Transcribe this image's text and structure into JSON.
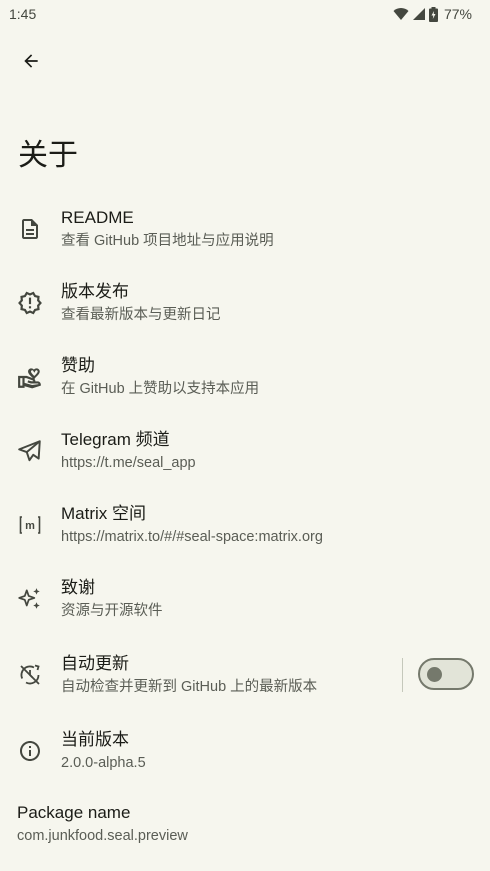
{
  "status": {
    "time": "1:45",
    "battery": "77%"
  },
  "page": {
    "title": "关于"
  },
  "items": [
    {
      "key": "readme",
      "title": "README",
      "desc": "查看 GitHub 项目地址与应用说明"
    },
    {
      "key": "releases",
      "title": "版本发布",
      "desc": "查看最新版本与更新日记"
    },
    {
      "key": "sponsor",
      "title": "赞助",
      "desc": "在 GitHub 上赞助以支持本应用"
    },
    {
      "key": "telegram",
      "title": "Telegram 频道",
      "desc": "https://t.me/seal_app"
    },
    {
      "key": "matrix",
      "title": "Matrix 空间",
      "desc": "https://matrix.to/#/#seal-space:matrix.org"
    },
    {
      "key": "credits",
      "title": "致谢",
      "desc": "资源与开源软件"
    },
    {
      "key": "auto_update",
      "title": "自动更新",
      "desc": "自动检查并更新到 GitHub 上的最新版本",
      "toggle": false
    },
    {
      "key": "version",
      "title": "当前版本",
      "desc": "2.0.0-alpha.5"
    }
  ],
  "package": {
    "title": "Package name",
    "value": "com.junkfood.seal.preview"
  },
  "icons": {
    "back": "arrow-back-icon",
    "readme": "description-icon",
    "releases": "new-releases-icon",
    "sponsor": "volunteer-activism-icon",
    "telegram": "send-icon",
    "matrix": "matrix-icon",
    "credits": "auto-awesome-icon",
    "auto_update": "update-disabled-icon",
    "version": "info-icon"
  }
}
